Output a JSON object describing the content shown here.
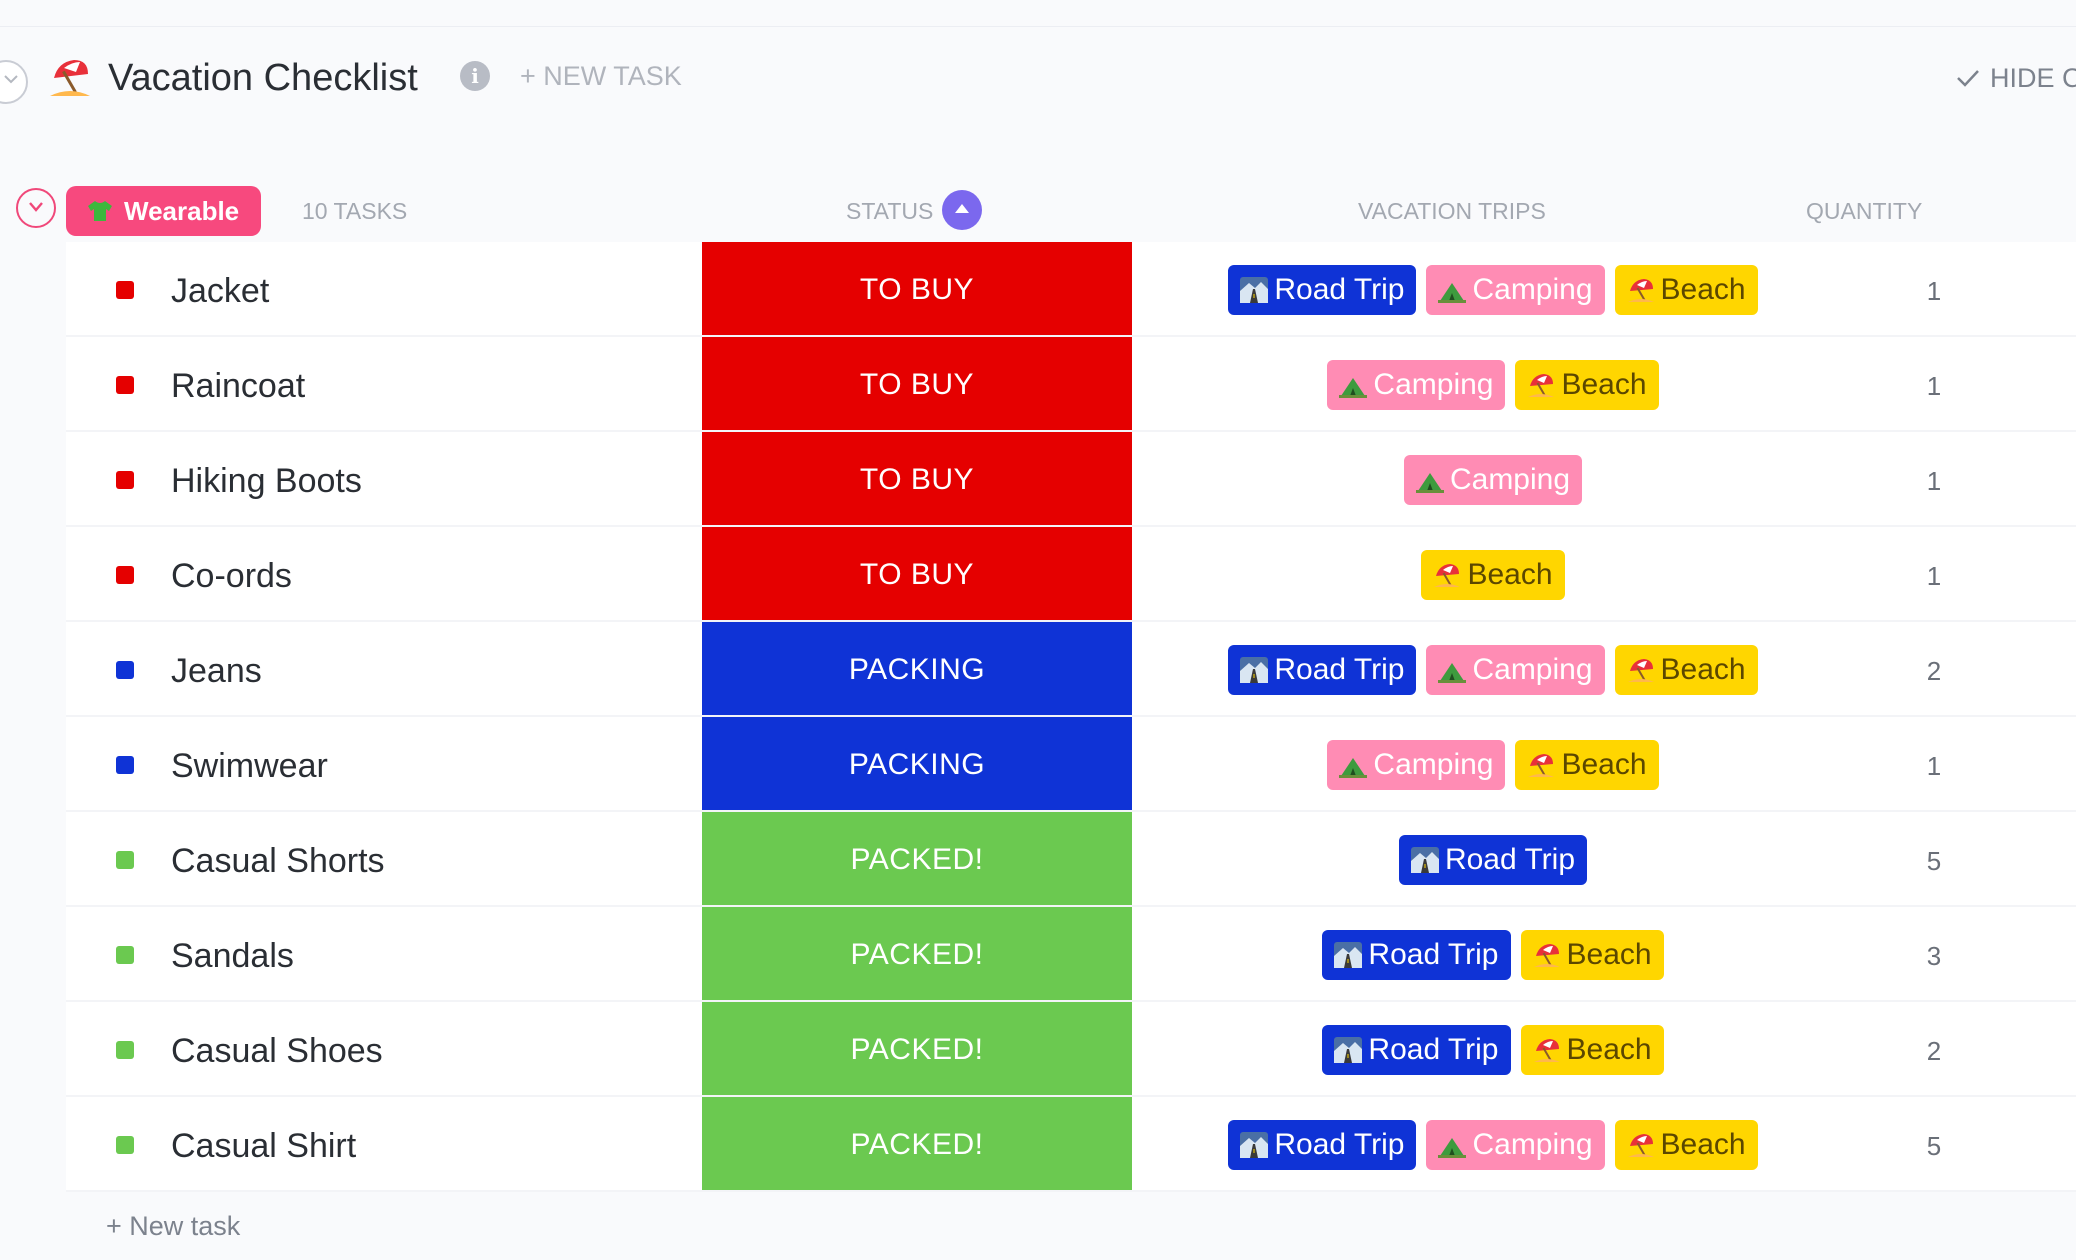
{
  "header": {
    "title": "Vacation Checklist",
    "info": "i",
    "new_task": "+ NEW TASK",
    "hide_label": "HIDE C"
  },
  "group": {
    "name": "Wearable",
    "task_count": "10 TASKS",
    "columns": {
      "status": "STATUS",
      "trips": "VACATION TRIPS",
      "quantity": "QUANTITY"
    }
  },
  "colors": {
    "to_buy": "#e50000",
    "packing": "#0f33d6",
    "packed": "#6bc950",
    "group_pink": "#f7497e"
  },
  "trip_labels": {
    "road": "Road Trip",
    "camp": "Camping",
    "beach": "Beach"
  },
  "tasks": [
    {
      "name": "Jacket",
      "status": "TO BUY",
      "status_key": "to_buy",
      "trips": [
        "road",
        "camp",
        "beach"
      ],
      "quantity": "1"
    },
    {
      "name": "Raincoat",
      "status": "TO BUY",
      "status_key": "to_buy",
      "trips": [
        "camp",
        "beach"
      ],
      "quantity": "1"
    },
    {
      "name": "Hiking Boots",
      "status": "TO BUY",
      "status_key": "to_buy",
      "trips": [
        "camp"
      ],
      "quantity": "1"
    },
    {
      "name": "Co-ords",
      "status": "TO BUY",
      "status_key": "to_buy",
      "trips": [
        "beach"
      ],
      "quantity": "1"
    },
    {
      "name": "Jeans",
      "status": "PACKING",
      "status_key": "packing",
      "trips": [
        "road",
        "camp",
        "beach"
      ],
      "quantity": "2"
    },
    {
      "name": "Swimwear",
      "status": "PACKING",
      "status_key": "packing",
      "trips": [
        "camp",
        "beach"
      ],
      "quantity": "1"
    },
    {
      "name": "Casual Shorts",
      "status": "PACKED!",
      "status_key": "packed",
      "trips": [
        "road"
      ],
      "quantity": "5"
    },
    {
      "name": "Sandals",
      "status": "PACKED!",
      "status_key": "packed",
      "trips": [
        "road",
        "beach"
      ],
      "quantity": "3"
    },
    {
      "name": "Casual Shoes",
      "status": "PACKED!",
      "status_key": "packed",
      "trips": [
        "road",
        "beach"
      ],
      "quantity": "2"
    },
    {
      "name": "Casual Shirt",
      "status": "PACKED!",
      "status_key": "packed",
      "trips": [
        "road",
        "camp",
        "beach"
      ],
      "quantity": "5"
    }
  ],
  "footer": {
    "new_task": "+ New task"
  }
}
